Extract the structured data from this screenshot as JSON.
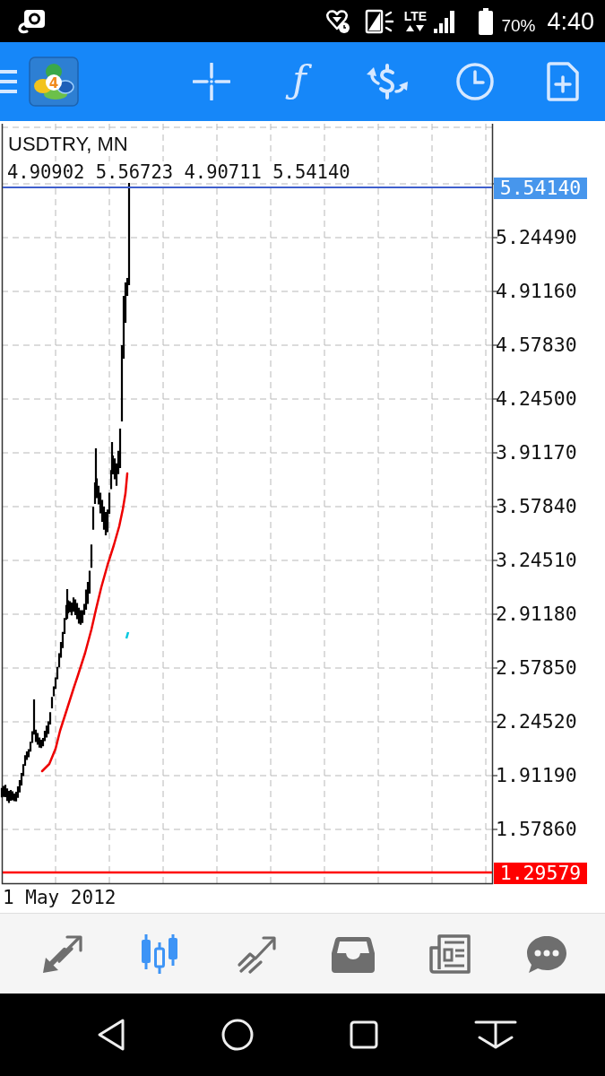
{
  "status_bar": {
    "network": "LTE",
    "battery": "70%",
    "time": "4:40"
  },
  "toolbar": {
    "logo_mark": "4",
    "function_glyph": "ƒ"
  },
  "chart": {
    "symbol": "USDTRY, MN",
    "ohlc": "4.90902 5.56723 4.90711 5.54140",
    "price_scale": [
      "5.24490",
      "4.91160",
      "4.57830",
      "4.24500",
      "3.91170",
      "3.57840",
      "3.24510",
      "2.91180",
      "2.57850",
      "2.24520",
      "1.91190",
      "1.57860"
    ],
    "current_price": "5.54140",
    "level_price": "1.29579",
    "start_date": "1 May 2012"
  },
  "bottom_tabs": [
    {
      "selected": false
    },
    {
      "selected": true
    },
    {
      "selected": false
    },
    {
      "selected": false
    },
    {
      "selected": false
    },
    {
      "selected": false
    }
  ]
}
